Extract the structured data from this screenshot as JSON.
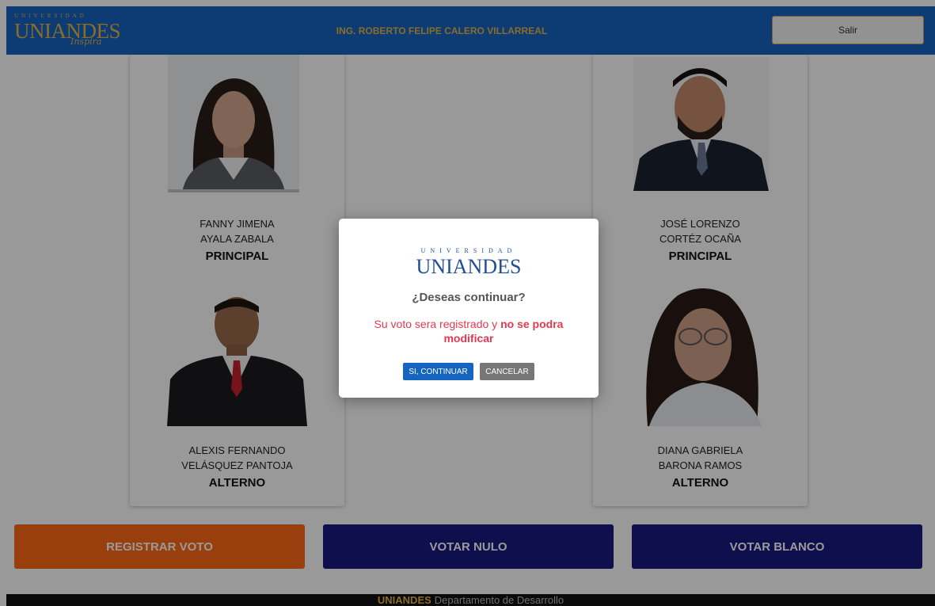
{
  "header": {
    "logo_tiny": "UNIVERSIDAD",
    "logo_name": "UNIANDES",
    "logo_tagline": "Inspira",
    "user_name": "ING. ROBERTO FELIPE CALERO VILLARREAL",
    "logout_label": "Salir"
  },
  "candidates": {
    "left": {
      "principal": {
        "name_line1": "FANNY JIMENA",
        "name_line2": "AYALA ZABALA",
        "role": "PRINCIPAL"
      },
      "alterno": {
        "name_line1": "ALEXIS FERNANDO",
        "name_line2": "VELÁSQUEZ PANTOJA",
        "role": "ALTERNO"
      }
    },
    "right": {
      "principal": {
        "name_line1": "JOSÉ LORENZO",
        "name_line2": "CORTÉZ OCAÑA",
        "role": "PRINCIPAL"
      },
      "alterno": {
        "name_line1": "DIANA GABRIELA",
        "name_line2": "BARONA RAMOS",
        "role": "ALTERNO"
      }
    }
  },
  "actions": {
    "register": "REGISTRAR VOTO",
    "null_vote": "VOTAR NULO",
    "blank_vote": "VOTAR BLANCO"
  },
  "footer": {
    "brand": "UNIANDES",
    "text": "Departamento de Desarrollo"
  },
  "modal": {
    "logo_tiny": "UNIVERSIDAD",
    "logo_name": "UNIANDES",
    "title": "¿Deseas continuar?",
    "message_normal": "Su voto sera registrado y",
    "message_bold": "no se podra modificar",
    "confirm_label": "SI, CONTINUAR",
    "cancel_label": "CANCELAR"
  },
  "colors": {
    "header_bg": "#1565c0",
    "gold": "#e6b543",
    "register_btn": "#ff6a18",
    "vote_btn": "#1a1a80",
    "modal_message": "#e03a52"
  }
}
